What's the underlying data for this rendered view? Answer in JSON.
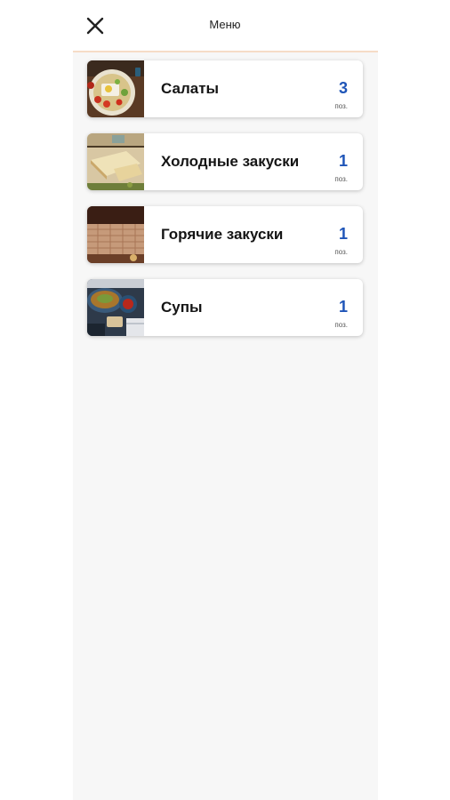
{
  "header": {
    "title": "Меню",
    "close_icon": "close-icon"
  },
  "colors": {
    "accent_count": "#1f55b8",
    "divider": "#f6dcc7",
    "list_background": "#f7f7f7"
  },
  "categories": [
    {
      "name": "Салаты",
      "count": "3",
      "unit": "поз.",
      "image": "salad-photo"
    },
    {
      "name": "Холодные закуски",
      "count": "1",
      "unit": "поз.",
      "image": "cold-appetizers-photo"
    },
    {
      "name": "Горячие закуски",
      "count": "1",
      "unit": "поз.",
      "image": "hot-appetizers-photo"
    },
    {
      "name": "Супы",
      "count": "1",
      "unit": "поз.",
      "image": "soup-photo"
    }
  ]
}
